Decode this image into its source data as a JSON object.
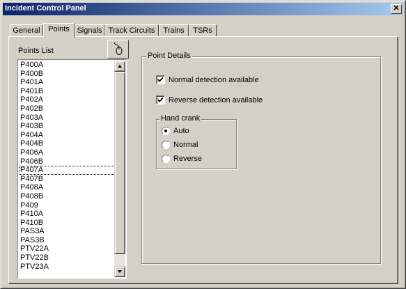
{
  "window": {
    "title": "Incident Control Panel",
    "close_glyph": "✕"
  },
  "tabs": [
    {
      "label": "General"
    },
    {
      "label": "Points"
    },
    {
      "label": "Signals"
    },
    {
      "label": "Track Circuits"
    },
    {
      "label": "Trains"
    },
    {
      "label": "TSRs"
    }
  ],
  "active_tab": "Points",
  "points_list": {
    "label": "Points List",
    "button_icon": "mouse-icon",
    "focused_item": "P407A",
    "items": [
      "P400A",
      "P400B",
      "P401A",
      "P401B",
      "P402A",
      "P402B",
      "P403A",
      "P403B",
      "P404A",
      "P404B",
      "P406A",
      "P406B",
      "P407A",
      "P407B",
      "P408A",
      "P408B",
      "P409",
      "P410A",
      "P410B",
      "PAS3A",
      "PAS3B",
      "PTV22A",
      "PTV22B",
      "PTV23A"
    ]
  },
  "point_details": {
    "title": "Point Details",
    "normal_detection": {
      "label": "Normal detection available",
      "checked": true
    },
    "reverse_detection": {
      "label": "Reverse detection available",
      "checked": true
    },
    "hand_crank": {
      "title": "Hand crank",
      "options": [
        {
          "label": "Auto",
          "selected": true
        },
        {
          "label": "Normal",
          "selected": false
        },
        {
          "label": "Reverse",
          "selected": false
        }
      ]
    }
  }
}
